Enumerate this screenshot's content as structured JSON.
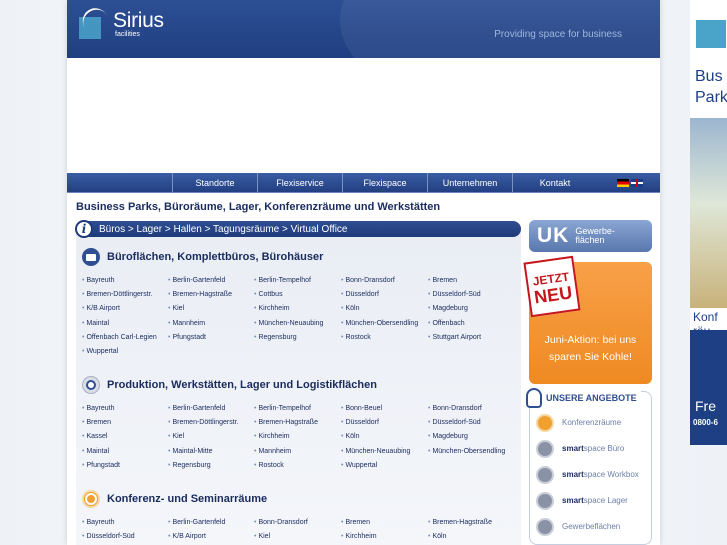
{
  "brand": {
    "name": "Sirius",
    "sub": "facilities",
    "tagline": "Providing space for business"
  },
  "nav": {
    "items": [
      "Standorte",
      "Flexiservice",
      "Flexispace",
      "Unternehmen",
      "Kontakt"
    ]
  },
  "headline": "Business Parks, Büroräume, Lager, Konferenzräume und Werkstätten",
  "breadcrumb": "Büros > Lager > Hallen > Tagungsräume > Virtual Office",
  "sections": [
    {
      "title": "Büroflächen, Komplettbüros, Bürohäuser",
      "links": [
        "Bayreuth",
        "Berlin-Gartenfeld",
        "Berlin-Tempelhof",
        "Bonn-Dransdorf",
        "Bremen",
        "Bremen-Döttlingerstr.",
        "Bremen-Hagstraße",
        "Cottbus",
        "Düsseldorf",
        "Düsseldorf-Süd",
        "K/B Airport",
        "Kiel",
        "Kirchheim",
        "Köln",
        "Magdeburg",
        "Maintal",
        "Mannheim",
        "München-Neuaubing",
        "München-Obersendling",
        "Offenbach",
        "Offenbach Carl-Legien",
        "Pfungstadt",
        "Regensburg",
        "Rostock",
        "Stuttgart Airport",
        "Wuppertal"
      ]
    },
    {
      "title": "Produktion, Werkstätten, Lager und Logistikflächen",
      "links": [
        "Bayreuth",
        "Berlin-Gartenfeld",
        "Berlin-Tempelhof",
        "Bonn-Beuel",
        "Bonn-Dransdorf",
        "Bremen",
        "Bremen-Döttlingerstr.",
        "Bremen-Hagstraße",
        "Düsseldorf",
        "Düsseldorf-Süd",
        "Kassel",
        "Kiel",
        "Kirchheim",
        "Köln",
        "Magdeburg",
        "Maintal",
        "Maintal-Mitte",
        "Mannheim",
        "München-Neuaubing",
        "München-Obersendling",
        "Pfungstadt",
        "Regensburg",
        "Rostock",
        "Wuppertal"
      ]
    },
    {
      "title": "Konferenz- und Seminarräume",
      "links": [
        "Bayreuth",
        "Berlin-Gartenfeld",
        "Bonn-Dransdorf",
        "Bremen",
        "Bremen-Hagstraße",
        "Düsseldorf-Süd",
        "K/B Airport",
        "Kiel",
        "Kirchheim",
        "Köln"
      ]
    }
  ],
  "uk_box": {
    "big": "UK",
    "small1": "Gewerbe-",
    "small2": "flächen"
  },
  "promo": {
    "stamp1": "JETZT",
    "stamp2": "NEU",
    "text": "Juni-Aktion: bei uns sparen Sie Kohle!"
  },
  "offers": {
    "title": "UNSERE ANGEBOTE",
    "items": [
      {
        "bold": "",
        "text": "Konferenzräume"
      },
      {
        "bold": "smart",
        "text": "space Büro"
      },
      {
        "bold": "smart",
        "text": "space Workbox"
      },
      {
        "bold": "smart",
        "text": "space Lager"
      },
      {
        "bold": "",
        "text": "Gewerbeflächen"
      }
    ]
  },
  "ad": {
    "line1": "Bus",
    "line2": "Park",
    "line3": "Konf",
    "line4": "räu",
    "line5": "Fre",
    "line6": "0800-6"
  }
}
